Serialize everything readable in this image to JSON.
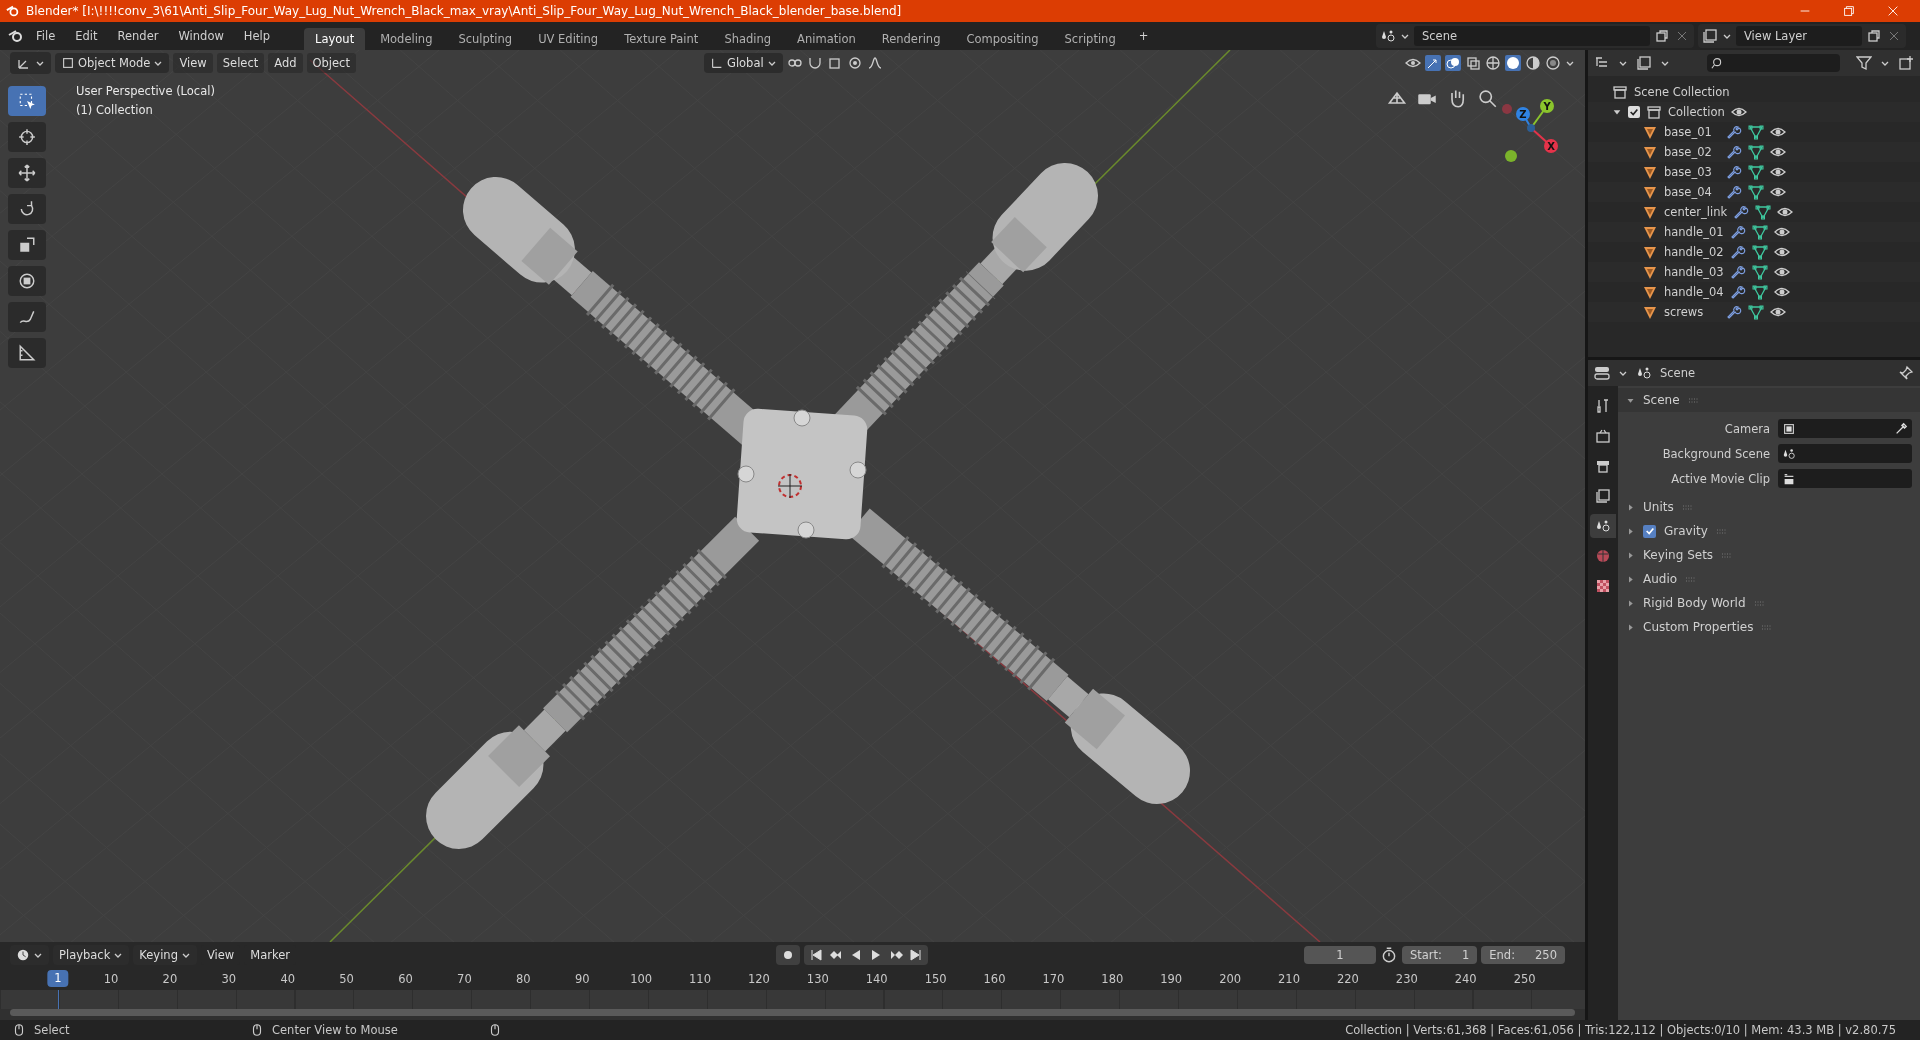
{
  "window": {
    "title": "Blender* [I:\\!!!!conv_3\\61\\Anti_Slip_Four_Way_Lug_Nut_Wrench_Black_max_vray\\Anti_Slip_Four_Way_Lug_Nut_Wrench_Black_blender_base.blend]"
  },
  "menu": [
    "File",
    "Edit",
    "Render",
    "Window",
    "Help"
  ],
  "workspaces": [
    {
      "label": "Layout",
      "selected": true
    },
    {
      "label": "Modeling",
      "selected": false
    },
    {
      "label": "Sculpting",
      "selected": false
    },
    {
      "label": "UV Editing",
      "selected": false
    },
    {
      "label": "Texture Paint",
      "selected": false
    },
    {
      "label": "Shading",
      "selected": false
    },
    {
      "label": "Animation",
      "selected": false
    },
    {
      "label": "Rendering",
      "selected": false
    },
    {
      "label": "Compositing",
      "selected": false
    },
    {
      "label": "Scripting",
      "selected": false
    }
  ],
  "add_workspace": "+",
  "scene_field": {
    "value": "Scene"
  },
  "view_layer_field": {
    "value": "View Layer"
  },
  "viewport": {
    "mode": "Object Mode",
    "menus": [
      "View",
      "Select",
      "Add",
      "Object"
    ],
    "orientation": "Global",
    "overlay_lines": [
      "User Perspective (Local)",
      "(1) Collection"
    ],
    "gizmo_axes": [
      {
        "label": "Z",
        "color": "#2f83e3"
      },
      {
        "label": "Y",
        "color": "#8bc52c"
      },
      {
        "label": "X",
        "color": "#e5334a"
      }
    ]
  },
  "outliner": {
    "root": "Scene Collection",
    "collections": [
      {
        "name": "Collection",
        "checked": true,
        "expanded": true,
        "children": [
          {
            "name": "base_01"
          },
          {
            "name": "base_02"
          },
          {
            "name": "base_03"
          },
          {
            "name": "base_04"
          },
          {
            "name": "center_link"
          },
          {
            "name": "handle_01"
          },
          {
            "name": "handle_02"
          },
          {
            "name": "handle_03"
          },
          {
            "name": "handle_04"
          },
          {
            "name": "screws"
          }
        ]
      }
    ]
  },
  "properties": {
    "title": "Scene",
    "tabs": [
      {
        "selected": false
      },
      {
        "selected": false
      },
      {
        "selected": false
      },
      {
        "selected": false
      },
      {
        "selected": true
      },
      {
        "selected": false
      },
      {
        "selected": false
      }
    ],
    "panels": [
      {
        "label": "Scene",
        "expanded": true,
        "fields": [
          "Camera",
          "Background Scene",
          "Active Movie Clip"
        ]
      },
      {
        "label": "Units",
        "expanded": false
      },
      {
        "label": "Gravity",
        "expanded": false,
        "checked": true
      },
      {
        "label": "Keying Sets",
        "expanded": false
      },
      {
        "label": "Audio",
        "expanded": false
      },
      {
        "label": "Rigid Body World",
        "expanded": false
      },
      {
        "label": "Custom Properties",
        "expanded": false
      }
    ]
  },
  "timeline": {
    "menus": [
      "Playback",
      "Keying",
      "View",
      "Marker"
    ],
    "current_frame": "1",
    "start_label": "Start:",
    "start": "1",
    "end_label": "End:",
    "end": "250",
    "ruler": [
      "1",
      "10",
      "20",
      "30",
      "40",
      "50",
      "60",
      "70",
      "80",
      "90",
      "100",
      "110",
      "120",
      "130",
      "140",
      "150",
      "160",
      "170",
      "180",
      "190",
      "200",
      "210",
      "220",
      "230",
      "240",
      "250"
    ]
  },
  "status_bar": {
    "hints": [
      "Select",
      "Center View to Mouse"
    ],
    "stats": "Collection | Verts:61,368 | Faces:61,056 | Tris:122,112 | Objects:0/10 | Mem: 43.3 MB | v2.80.75"
  }
}
